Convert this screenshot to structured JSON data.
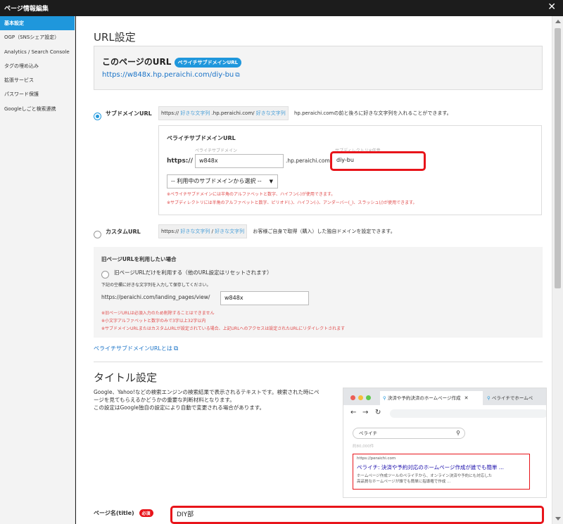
{
  "window": {
    "title": "ページ情報編集"
  },
  "sidebar": {
    "items": [
      {
        "label": "基本設定"
      },
      {
        "label": "OGP（SNSシェア設定）"
      },
      {
        "label": "Analytics / Search Console"
      },
      {
        "label": "タグの埋め込み"
      },
      {
        "label": "拡張サービス"
      },
      {
        "label": "パスワード保護"
      },
      {
        "label": "Googleしごと検索連携"
      }
    ]
  },
  "url_settings": {
    "heading": "URL設定",
    "page_url_label": "このページのURL",
    "page_url_badge": "ペライチサブドメインURL",
    "page_url": "https://w848x.hp.peraichi.com/diy-bu",
    "subdomain": {
      "label": "サブドメインURL",
      "prefix": "https://",
      "placeholder1": "好きな文字列",
      "mid": ".hp.peraichi.com/",
      "placeholder2": "好きな文字列",
      "note": "hp.peraichi.comの前と後ろに好きな文字列を入れることができます。"
    },
    "subbox": {
      "heading": "ペライチサブドメインURL",
      "https_label": "https://",
      "sub_label": "ペライチサブドメイン",
      "sub_value": "w848x",
      "domain_label": ".hp.peraichi.com",
      "dir_label": "サブディレクトリ※任意",
      "dir_value": "diy-bu",
      "select_value": "-- 利用中のサブドメインから選択 --",
      "note1": "※ペライチサブドメインには半角のアルファベットと数字、ハイフン(-)が使用できます。",
      "note2": "※サブディレクトリには半角のアルファベットと数字、ピリオド(.)、ハイフン(-)、アンダーバー(_)、スラッシュ(/)が使用できます。"
    },
    "custom": {
      "label": "カスタムURL",
      "prefix": "https://",
      "placeholder1": "好きな文字列",
      "sep": "/",
      "placeholder2": "好きな文字列",
      "note": "お客様ご自身で取得（購入）した独自ドメインを設定できます。"
    },
    "old": {
      "heading": "旧ページURLを利用したい場合",
      "radio_label": "旧ページURLだけを利用する（他のURL設定はリセットされます）",
      "instruction": "下記の空欄に好きな文字列を入力して保存してください。",
      "prefix": "https://peraichi.com/landing_pages/view/",
      "value": "w848x",
      "note1": "※旧ページURLは必須入力のため削除することはできません",
      "note2": "※小文字アルファベットと数字のみで3字以上32字以内",
      "note3": "※サブドメインURLまたはカスタムURLが設定されている場合、上記URLへのアクセスは設定されたURLにリダイレクトされます"
    },
    "about_link": "ペライチサブドメインURLとは"
  },
  "title_settings": {
    "heading": "タイトル設定",
    "desc1": "Google、Yahoo!などの検索エンジンの検索結果で表示されるテキストです。検索された時にペ",
    "desc2": "ージを見てもらえるかどうかの重要な判断材料となります。",
    "desc3": "この設定はGoogle独自の設定により自動で変更される場合があります。",
    "preview": {
      "tab1": "決済や予約決済のホームページ作成",
      "tab2": "ペライチでホームペ",
      "search_query": "ペライチ",
      "result_count": "約80,000件",
      "result_url": "https://peraichi.com",
      "result_title": "ペライチ: 決済や予約対応のホームページ作成が誰でも簡単 ...",
      "result_desc1": "ホームページ作成ツールのペライチから、オンライン決済や予約にも対応した",
      "result_desc2": "高品質なホームページが誰でも簡単に指導権で作成 ..."
    },
    "page_name_label": "ページ名(title)",
    "required_badge": "必須",
    "page_name_value": "DIY部"
  },
  "colors": {
    "accent": "#1f97dc",
    "highlight": "#e8141a",
    "note": "#e04a4a"
  }
}
